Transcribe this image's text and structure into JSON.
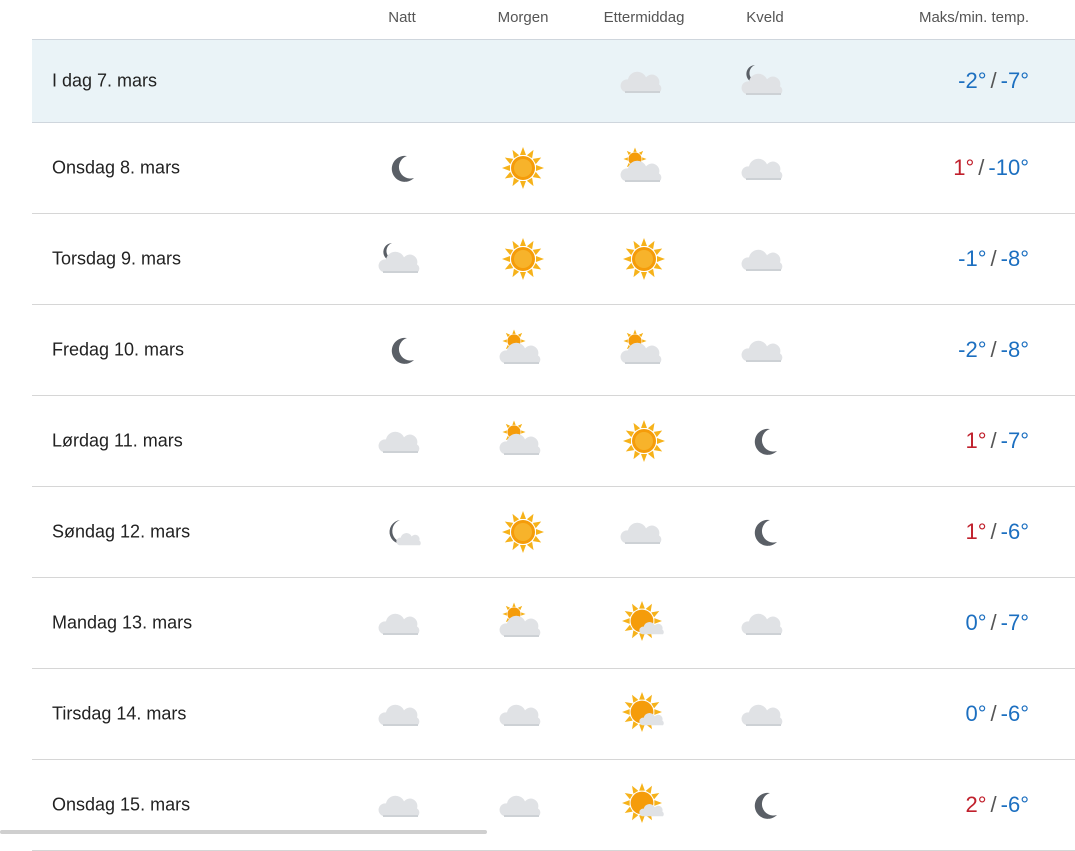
{
  "header": {
    "columns": [
      {
        "key": "natt",
        "label": "Natt"
      },
      {
        "key": "morgen",
        "label": "Morgen"
      },
      {
        "key": "ettermiddag",
        "label": "Ettermiddag"
      },
      {
        "key": "kveld",
        "label": "Kveld"
      }
    ],
    "temp_label": "Maks/min. temp."
  },
  "colors": {
    "warm": "#c0202c",
    "cold": "#1c6fc0",
    "today_bg": "#eaf3f7"
  },
  "rows": [
    {
      "day": "I dag 7. mars",
      "today": true,
      "icons": [
        "",
        "",
        "cloud",
        "moon-cloud"
      ],
      "max": "-2°",
      "min": "-7°",
      "max_class": "cold"
    },
    {
      "day": "Onsdag 8. mars",
      "icons": [
        "moon",
        "sun",
        "sun-cloud",
        "cloud"
      ],
      "max": "1°",
      "min": "-10°",
      "max_class": "warm"
    },
    {
      "day": "Torsdag 9. mars",
      "icons": [
        "moon-cloud",
        "sun",
        "sun",
        "cloud"
      ],
      "max": "-1°",
      "min": "-8°",
      "max_class": "cold"
    },
    {
      "day": "Fredag 10. mars",
      "icons": [
        "moon",
        "sun-cloud",
        "sun-cloud",
        "cloud"
      ],
      "max": "-2°",
      "min": "-8°",
      "max_class": "cold"
    },
    {
      "day": "Lørdag 11. mars",
      "icons": [
        "cloud",
        "sun-cloud",
        "sun",
        "moon"
      ],
      "max": "1°",
      "min": "-7°",
      "max_class": "warm"
    },
    {
      "day": "Søndag 12. mars",
      "icons": [
        "moon-small-cloud",
        "sun",
        "cloud",
        "moon"
      ],
      "max": "1°",
      "min": "-6°",
      "max_class": "warm"
    },
    {
      "day": "Mandag 13. mars",
      "icons": [
        "cloud",
        "sun-cloud",
        "sun-small-cloud",
        "cloud"
      ],
      "max": "0°",
      "min": "-7°",
      "max_class": "cold"
    },
    {
      "day": "Tirsdag 14. mars",
      "icons": [
        "cloud",
        "cloud",
        "sun-small-cloud",
        "cloud"
      ],
      "max": "0°",
      "min": "-6°",
      "max_class": "cold"
    },
    {
      "day": "Onsdag 15. mars",
      "icons": [
        "cloud",
        "cloud",
        "sun-small-cloud",
        "moon"
      ],
      "max": "2°",
      "min": "-6°",
      "max_class": "warm"
    }
  ]
}
